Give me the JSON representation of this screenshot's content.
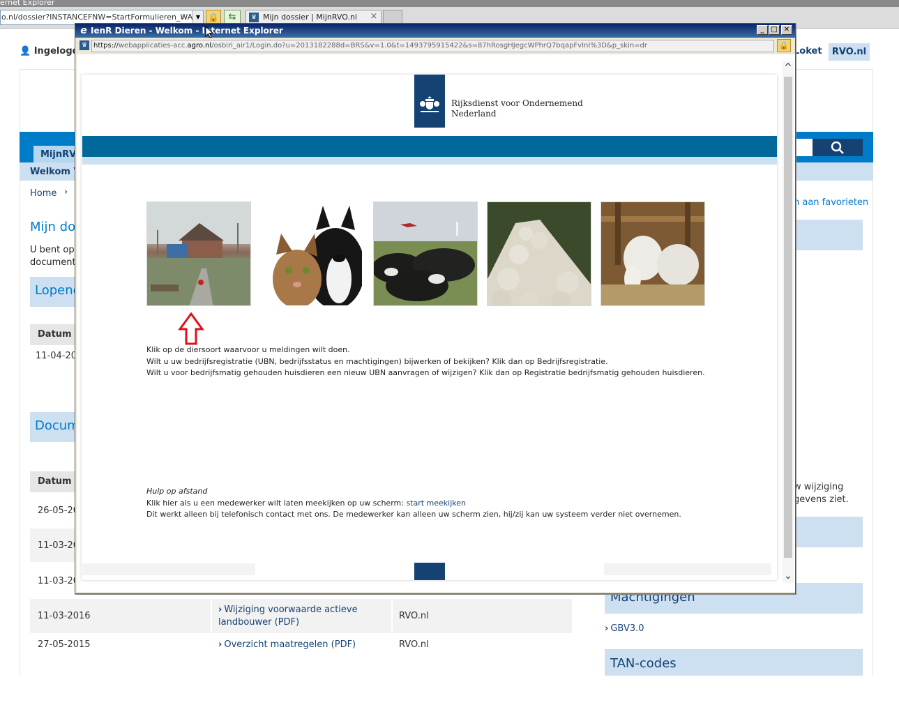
{
  "background_browser": {
    "title_fragment": "ernet Explorer",
    "address": "o.nl/dossier?INSTANCEFNW=StartFormulieren_WAR",
    "tab_label": "Mijn dossier | MijnRVO.nl",
    "tab_close": "×"
  },
  "background_page": {
    "user_label": "Ingelogd",
    "loket_label": "Loket",
    "rvo_button": "RVO.nl",
    "mijnrvo_tab": "MijnRVO",
    "welcome": "Welkom V",
    "home": "Home",
    "breadcrumb_sep": "›",
    "favorites": "n aan favorieten",
    "page_title": "Mijn dos",
    "intro_line1": "U bent op",
    "intro_line2": "documente",
    "lopend_heading": "Lopend",
    "documents_heading": "Docum",
    "col_datum": "Datum",
    "lopend_row_date": "11-04-20",
    "doc_rows_partial": [
      "26-05-20",
      "11-03-20",
      "11-03-20"
    ],
    "side_note_line1": "w wijziging",
    "side_note_line2": "gevens ziet.",
    "doc_rows_full": [
      {
        "date": "11-03-2016",
        "title": "Wijziging voorwaarde actieve landbouwer (PDF)",
        "source": "RVO.nl"
      },
      {
        "date": "27-05-2015",
        "title": "Overzicht maatregelen (PDF)",
        "source": "RVO.nl"
      }
    ],
    "machtigingen_heading": "Machtigingen",
    "gbv_link": "GBV3.0",
    "tan_heading": "TAN-codes"
  },
  "popup": {
    "title": "IenR Dieren - Welkom - Internet Explorer",
    "url_scheme": "https://",
    "url_host_pre": "webapplicaties-acc.",
    "url_host": "agro.nl",
    "url_rest": "/osbiri_air1/Login.do?u=2013182288d=BRS&v=1.0&t=1493795915422&s=87hRosgHJegcWPhrQ7bqapFvInI%3D&p_skin=dr",
    "org_line1": "Rijksdienst voor Ondernemend",
    "org_line2": "Nederland",
    "instructions": [
      "Klik op de diersoort waarvoor u meldingen wilt doen.",
      "Wilt u uw bedrijfsregistratie (UBN, bedrijfsstatus en machtigingen) bijwerken of bekijken? Klik dan op Bedrijfsregistratie.",
      "Wilt u voor bedrijfsmatig gehouden huisdieren een nieuw UBN aanvragen of wijzigen? Klik dan op Registratie bedrijfsmatig gehouden huisdieren."
    ],
    "help_title": "Hulp op afstand",
    "help_line1_prefix": "Klik hier als u een medewerker wilt laten meekijken op uw scherm: ",
    "help_link": "start meekijken",
    "help_line2": "Dit werkt alleen bij telefonisch contact met ons. De medewerker kan alleen uw scherm zien, hij/zij kan uw systeem verder niet overnemen."
  },
  "colors": {
    "rvo_dark_blue": "#154273",
    "rvo_blue": "#007bc7",
    "rvo_light_blue": "#cce0f1",
    "teal_bar": "#01689b",
    "arrow_red": "#e0101a"
  }
}
